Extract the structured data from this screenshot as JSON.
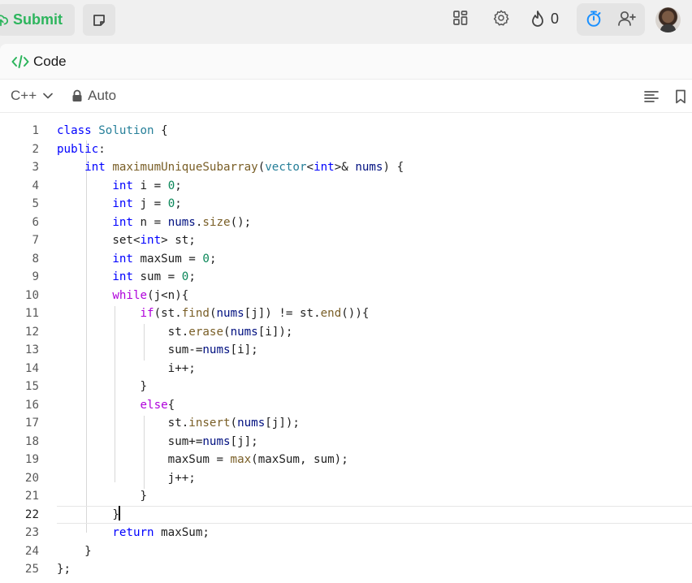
{
  "topbar": {
    "submit_label": "Submit",
    "streak_count": "0",
    "colors": {
      "submit": "#2db55d",
      "timer": "#1a90ff"
    },
    "icons": [
      "cloud-upload-icon",
      "note-icon",
      "layout-icon",
      "gear-icon",
      "flame-icon",
      "stopwatch-icon",
      "add-user-icon",
      "avatar"
    ]
  },
  "panel": {
    "title": "Code"
  },
  "toolbar": {
    "language": "C++",
    "mode": "Auto"
  },
  "editor": {
    "active_line": 22,
    "lines": [
      {
        "num": "1",
        "text": "class Solution {"
      },
      {
        "num": "2",
        "text": "public:"
      },
      {
        "num": "3",
        "text": "    int maximumUniqueSubarray(vector<int>& nums) {"
      },
      {
        "num": "4",
        "text": "        int i = 0;"
      },
      {
        "num": "5",
        "text": "        int j = 0;"
      },
      {
        "num": "6",
        "text": "        int n = nums.size();"
      },
      {
        "num": "7",
        "text": "        set<int> st;"
      },
      {
        "num": "8",
        "text": "        int maxSum = 0;"
      },
      {
        "num": "9",
        "text": "        int sum = 0;"
      },
      {
        "num": "10",
        "text": "        while(j<n){"
      },
      {
        "num": "11",
        "text": "            if(st.find(nums[j]) != st.end()){"
      },
      {
        "num": "12",
        "text": "                st.erase(nums[i]);"
      },
      {
        "num": "13",
        "text": "                sum-=nums[i];"
      },
      {
        "num": "14",
        "text": "                i++;"
      },
      {
        "num": "15",
        "text": "            }"
      },
      {
        "num": "16",
        "text": "            else{"
      },
      {
        "num": "17",
        "text": "                st.insert(nums[j]);"
      },
      {
        "num": "18",
        "text": "                sum+=nums[j];"
      },
      {
        "num": "19",
        "text": "                maxSum = max(maxSum, sum);"
      },
      {
        "num": "20",
        "text": "                j++;"
      },
      {
        "num": "21",
        "text": "            }"
      },
      {
        "num": "22",
        "text": "        }"
      },
      {
        "num": "23",
        "text": "        return maxSum;"
      },
      {
        "num": "24",
        "text": "    }"
      },
      {
        "num": "25",
        "text": "};"
      }
    ]
  }
}
